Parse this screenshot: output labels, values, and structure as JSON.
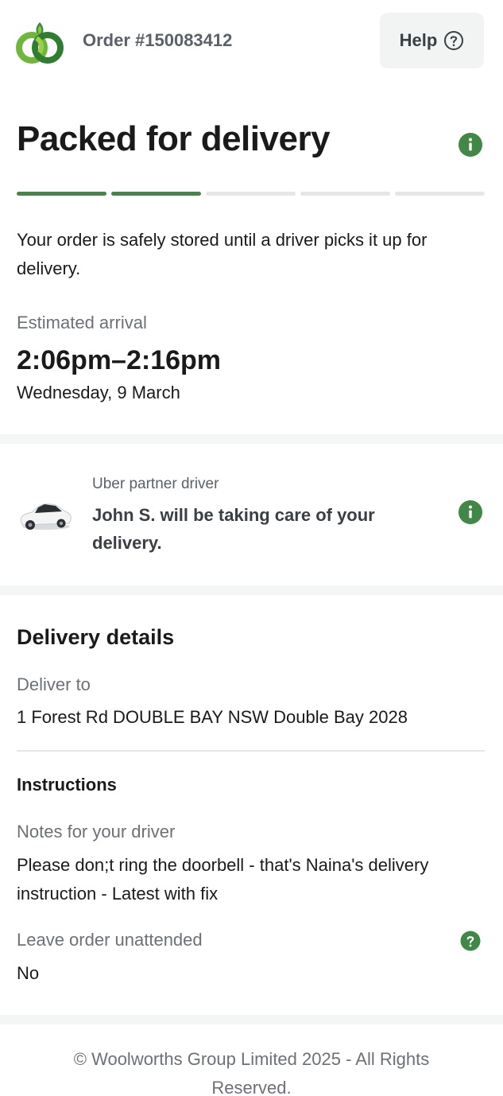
{
  "header": {
    "order_label": "Order #150083412",
    "help_label": "Help",
    "logo_icon": "woolworths-logo-icon",
    "help_icon": "question-circle-icon"
  },
  "status": {
    "title": "Packed for delivery",
    "info_icon": "info-circle-icon",
    "progress": {
      "completed_steps": 2,
      "total_steps": 5
    },
    "description": "Your order is safely stored until a driver picks it up for delivery."
  },
  "eta": {
    "label": "Estimated arrival",
    "time": "2:06pm–2:16pm",
    "date": "Wednesday, 9 March"
  },
  "driver": {
    "label": "Uber partner driver",
    "text": "John S. will be taking care of your delivery.",
    "car_icon": "car-icon",
    "info_icon": "info-circle-icon"
  },
  "delivery_details": {
    "title": "Delivery details",
    "deliver_to_label": "Deliver to",
    "deliver_to_value": "1 Forest Rd DOUBLE BAY NSW Double Bay 2028",
    "instructions_title": "Instructions",
    "notes_label": "Notes for your driver",
    "notes_value": "Please don;t ring the doorbell - that's Naina's delivery instruction - Latest with fix",
    "unattended_label": "Leave order unattended",
    "unattended_value": "No",
    "unattended_help_icon": "question-circle-icon"
  },
  "footer": {
    "text": "© Woolworths Group Limited 2025 - All Rights Reserved."
  },
  "colors": {
    "brand_green": "#3f8845",
    "progress_inactive": "#e5e6e7",
    "muted_text": "#6b7177",
    "band_gray": "#f4f5f5"
  }
}
